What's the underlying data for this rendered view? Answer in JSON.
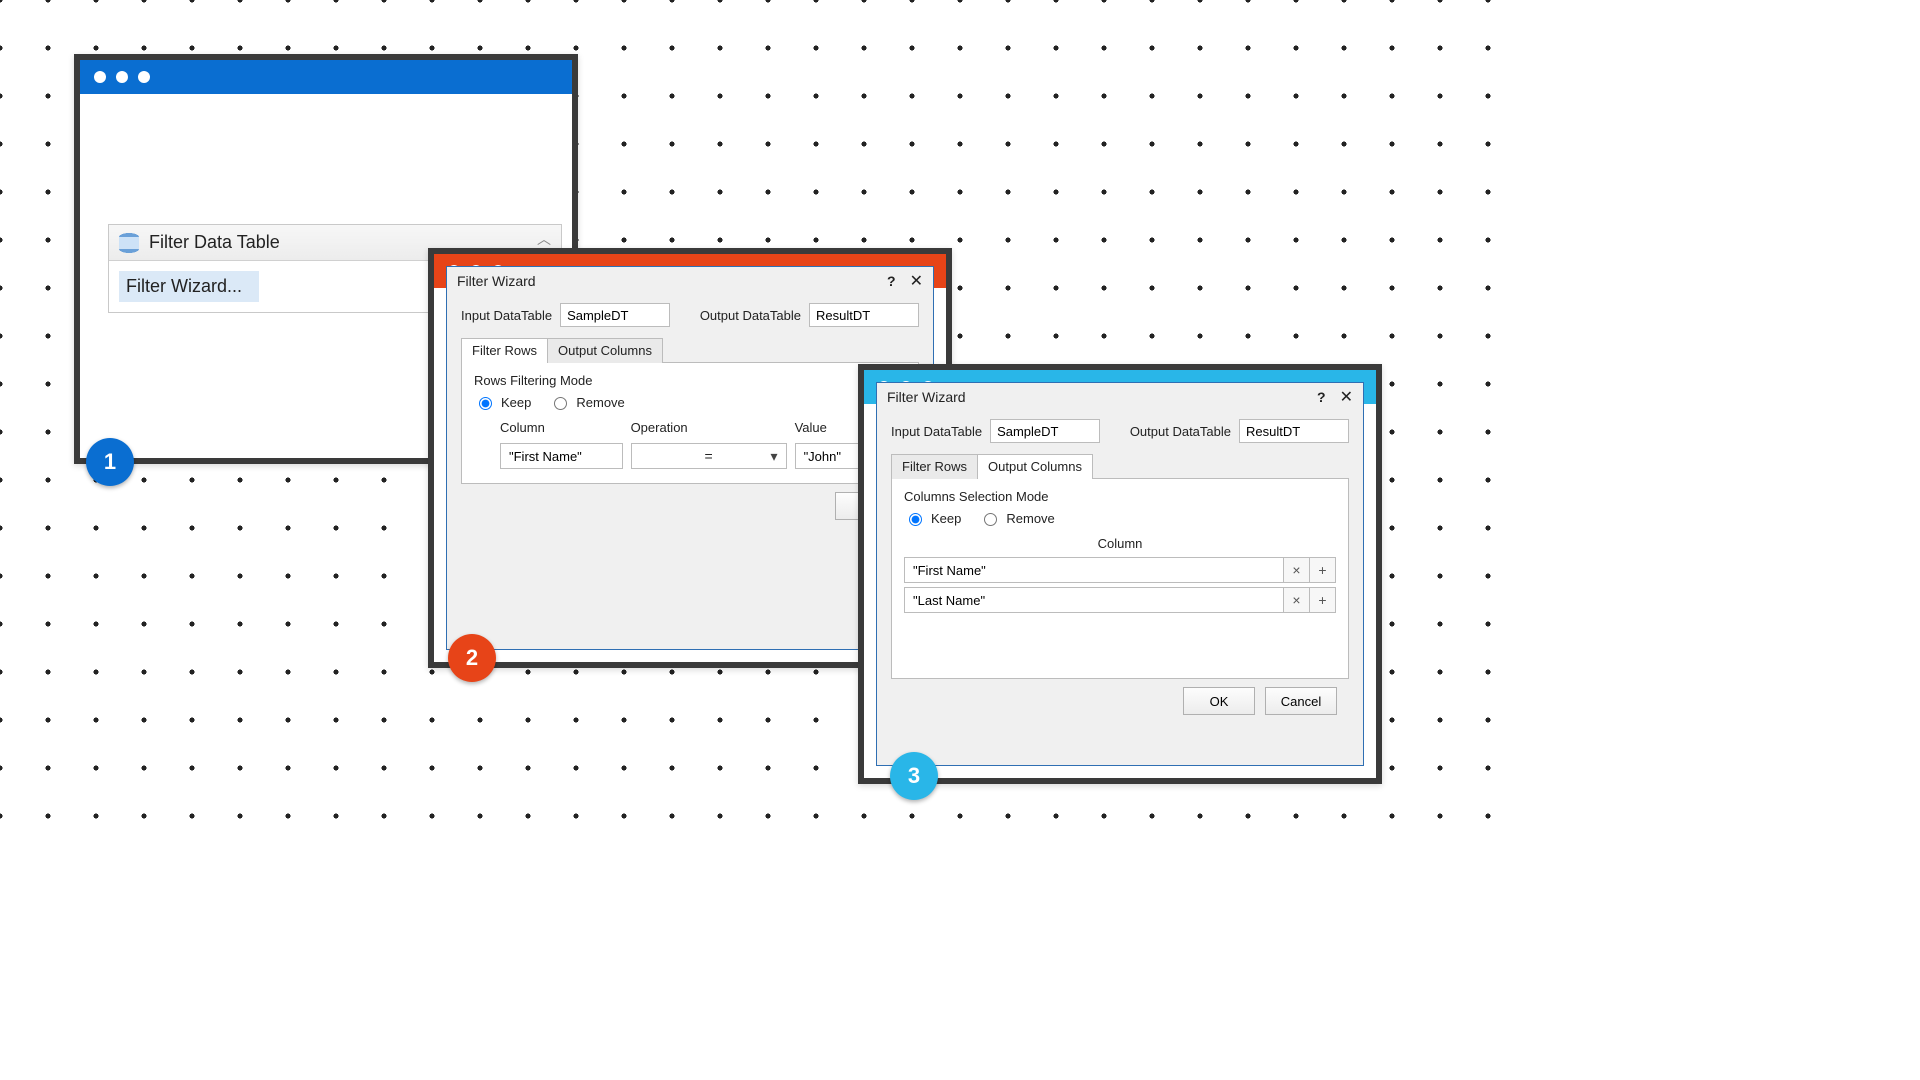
{
  "steps": {
    "one": "1",
    "two": "2",
    "three": "3"
  },
  "activity": {
    "title": "Filter Data Table",
    "wizard_link": "Filter Wizard..."
  },
  "dialog": {
    "title": "Filter Wizard",
    "input_label": "Input DataTable",
    "input_value": "SampleDT",
    "output_label": "Output DataTable",
    "output_value": "ResultDT",
    "tabs": {
      "rows": "Filter Rows",
      "cols": "Output Columns"
    },
    "ok": "OK",
    "cancel": "Cancel"
  },
  "rows_tab": {
    "mode_label": "Rows Filtering Mode",
    "keep": "Keep",
    "remove": "Remove",
    "headers": {
      "column": "Column",
      "operation": "Operation",
      "value": "Value"
    },
    "row": {
      "column": "\"First Name\"",
      "operation": "=",
      "value": "\"John\""
    }
  },
  "cols_tab": {
    "mode_label": "Columns Selection Mode",
    "keep": "Keep",
    "remove": "Remove",
    "header": "Column",
    "rows": [
      "\"First Name\"",
      "\"Last Name\""
    ]
  }
}
